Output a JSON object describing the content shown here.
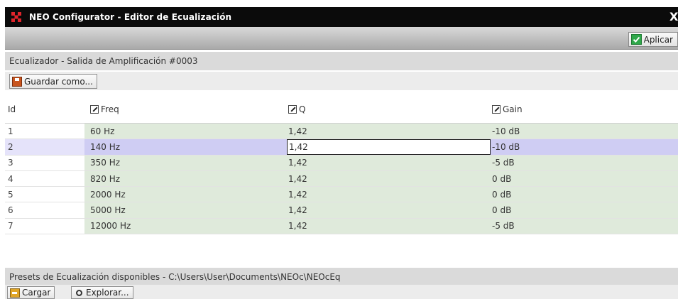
{
  "window": {
    "title": "NEO Configurator - Editor de Ecualización",
    "close_glyph": "X"
  },
  "toolbar": {
    "apply_label": "Aplicar"
  },
  "eq_section": {
    "header": "Ecualizador - Salida de Amplificación #0003",
    "save_as_label": "Guardar como..."
  },
  "grid": {
    "columns": {
      "id": "Id",
      "freq": "Freq",
      "q": "Q",
      "gain": "Gain"
    },
    "rows": [
      {
        "id": "1",
        "freq": "60 Hz",
        "q": "1,42",
        "gain": "-10 dB"
      },
      {
        "id": "2",
        "freq": "140 Hz",
        "q": "1,42",
        "gain": "-10 dB"
      },
      {
        "id": "3",
        "freq": "350 Hz",
        "q": "1,42",
        "gain": "-5 dB"
      },
      {
        "id": "4",
        "freq": "820 Hz",
        "q": "1,42",
        "gain": "0 dB"
      },
      {
        "id": "5",
        "freq": "2000 Hz",
        "q": "1,42",
        "gain": "0 dB"
      },
      {
        "id": "6",
        "freq": "5000 Hz",
        "q": "1,42",
        "gain": "0 dB"
      },
      {
        "id": "7",
        "freq": "12000 Hz",
        "q": "1,42",
        "gain": "-5 dB"
      }
    ]
  },
  "presets": {
    "header": "Presets de Ecualización disponibles - C:\\Users\\User\\Documents\\NEOc\\NEOcEq",
    "load_label": "Cargar",
    "browse_label": "Explorar..."
  },
  "colors": {
    "titlebar": "#0b0b0b",
    "row_fill": "#dfeadb",
    "selected_row": "#cfcdf3",
    "app_icon": "#e0242b"
  }
}
